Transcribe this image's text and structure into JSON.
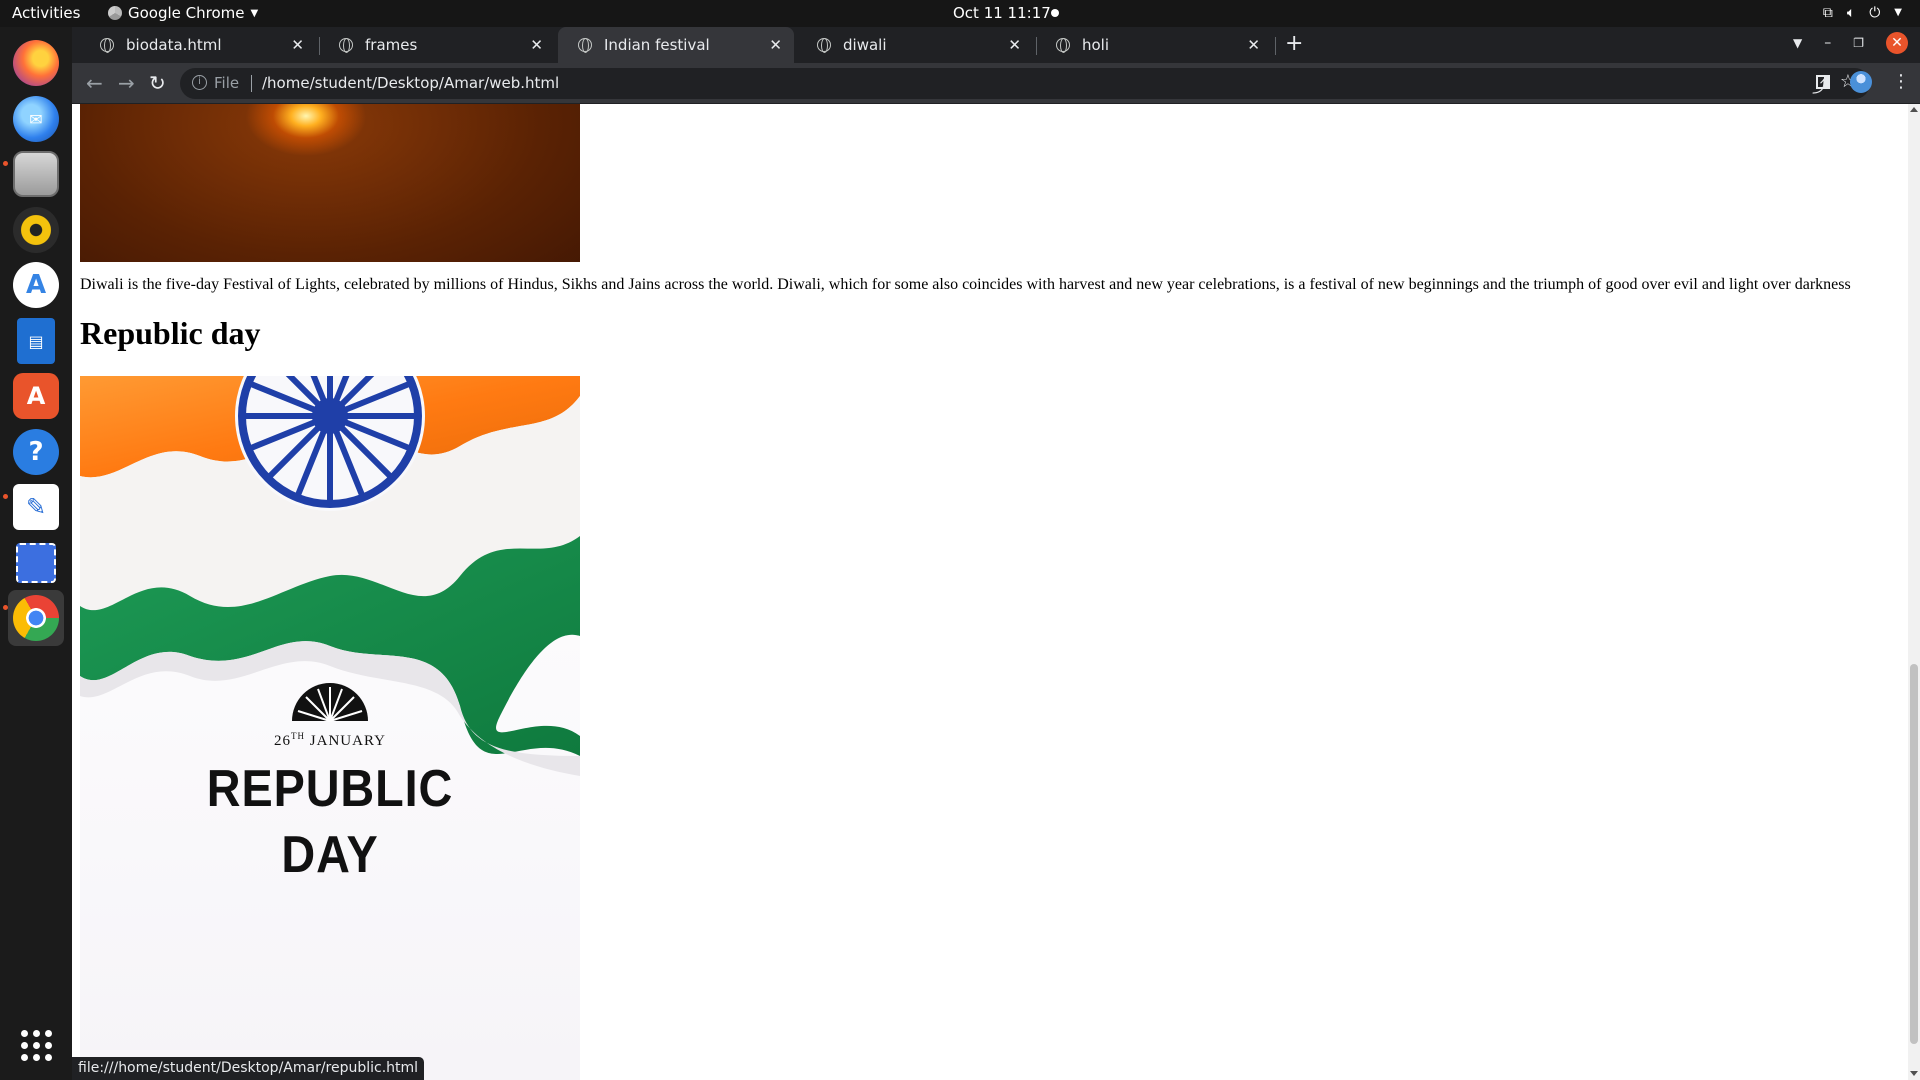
{
  "topbar": {
    "activities": "Activities",
    "app_name": "Google Chrome",
    "clock": "Oct 11  11:17"
  },
  "dock": {
    "items": [
      {
        "name": "firefox-icon",
        "color": "#ff7139"
      },
      {
        "name": "thunderbird-icon",
        "color": "#2f80ed"
      },
      {
        "name": "files-icon",
        "color": "#9b9b9b"
      },
      {
        "name": "rhythmbox-icon",
        "color": "#f4c20d"
      },
      {
        "name": "app-center-icon",
        "color": "#3584e4"
      },
      {
        "name": "libreoffice-writer-icon",
        "color": "#1f6fd1"
      },
      {
        "name": "software-store-icon",
        "color": "#e9542b"
      },
      {
        "name": "help-icon",
        "color": "#2a7de1"
      },
      {
        "name": "text-editor-icon",
        "color": "#2a6fd6"
      },
      {
        "name": "screenshot-icon",
        "color": "#3c6fe0"
      },
      {
        "name": "chrome-icon",
        "color": "#4285f4"
      }
    ]
  },
  "tabs": [
    {
      "label": "biodata.html",
      "active": false
    },
    {
      "label": "frames",
      "active": false
    },
    {
      "label": "Indian festival",
      "active": true
    },
    {
      "label": "diwali",
      "active": false
    },
    {
      "label": "holi",
      "active": false
    }
  ],
  "toolbar": {
    "scheme": "File",
    "url": "/home/student/Desktop/Amar/web.html"
  },
  "page": {
    "diwali_paragraph": "Diwali is the five-day Festival of Lights, celebrated by millions of Hindus, Sikhs and Jains across the world. Diwali, which for some also coincides with harvest and new year celebrations, is a festival of new beginnings and the triumph of good over evil and light over darkness",
    "republic_heading": "Republic day",
    "republic_image": {
      "date_num": "26",
      "date_sup": "TH",
      "date_month": "JANUARY",
      "title_line1": "REPUBLIC",
      "title_line2": "DAY"
    }
  },
  "status_bar": {
    "link": "file:///home/student/Desktop/Amar/republic.html"
  },
  "colors": {
    "saffron": "#ff8a1f",
    "green": "#138a4a",
    "chakra_blue": "#1f3fa8"
  }
}
